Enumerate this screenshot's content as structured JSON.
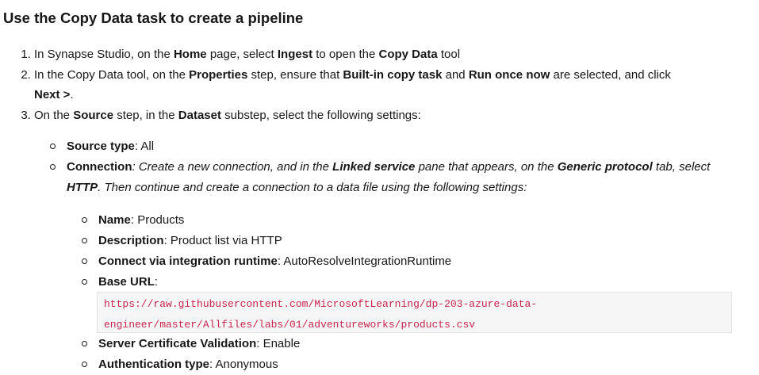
{
  "heading": "Use the Copy Data task to create a pipeline",
  "steps": [
    {
      "pre1": "In Synapse Studio, on the ",
      "b1": "Home",
      "mid1": " page, select ",
      "b2": "Ingest",
      "mid2": " to open the ",
      "b3": "Copy Data",
      "post": " tool"
    },
    {
      "pre1": "In the Copy Data tool, on the ",
      "b1": "Properties",
      "mid1": " step, ensure that ",
      "b2": "Built-in copy task",
      "mid2": " and ",
      "b3": "Run once now",
      "mid3": " are selected, and click ",
      "b4": "Next >",
      "post": "."
    },
    {
      "pre1": "On the ",
      "b1": "Source",
      "mid1": " step, in the ",
      "b2": "Dataset",
      "post": " substep, select the following settings:"
    }
  ],
  "source_settings": {
    "source_type_label": "Source type",
    "source_type_value": ": All",
    "connection_label": "Connection",
    "connection_text_1": ": Create a new connection, and in the ",
    "connection_b1": "Linked service",
    "connection_text_2": " pane that appears, on the ",
    "connection_b2": "Generic protocol",
    "connection_text_3": " tab, select ",
    "connection_b3": "HTTP",
    "connection_text_4": ". Then continue and create a connection to a data file using the following settings:"
  },
  "connection_settings": [
    {
      "label": "Name",
      "value": ": Products"
    },
    {
      "label": "Description",
      "value": ": Product list via HTTP"
    },
    {
      "label": "Connect via integration runtime",
      "value": ": AutoResolveIntegrationRuntime"
    },
    {
      "label": "Base URL",
      "value": ":"
    }
  ],
  "base_url_line1": "https://raw.githubusercontent.com/MicrosoftLearning/dp-203-azure-data-",
  "base_url_line2": "engineer/master/Allfiles/labs/01/adventureworks/products.csv",
  "more_settings": [
    {
      "label": "Server Certificate Validation",
      "value": ": Enable"
    },
    {
      "label": "Authentication type",
      "value": ": Anonymous"
    }
  ]
}
